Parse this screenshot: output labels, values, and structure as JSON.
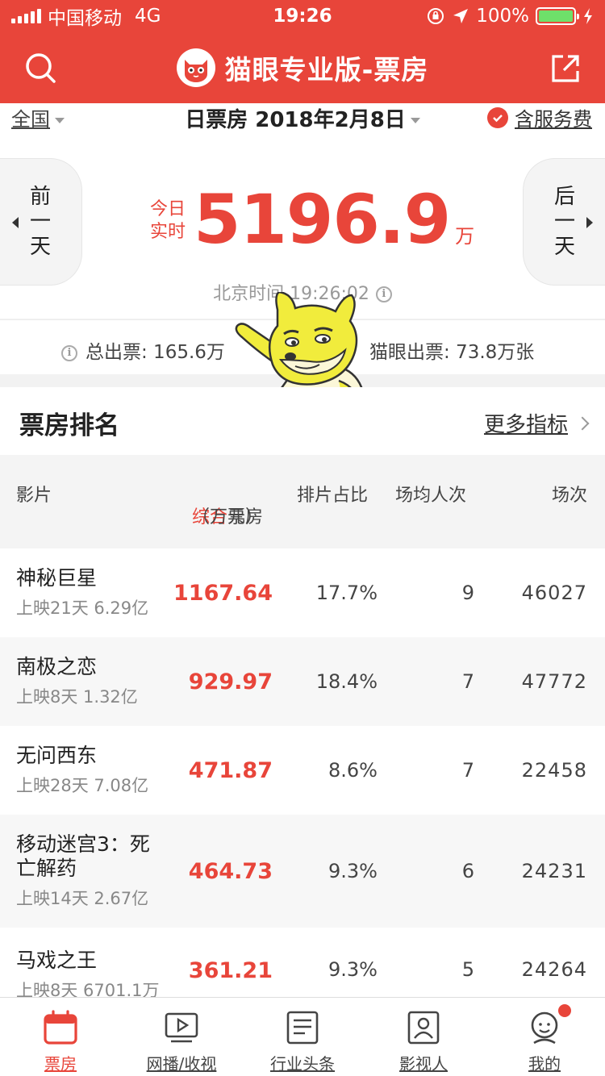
{
  "status_bar": {
    "carrier": "中国移动",
    "network": "4G",
    "time": "19:26",
    "battery": "100%"
  },
  "header": {
    "title": "猫眼专业版-票房",
    "icons": [
      "search-icon",
      "maoyan-logo",
      "share-icon"
    ]
  },
  "filter": {
    "region": "全国",
    "date": "日票房 2018年2月8日",
    "service_fee": "含服务费"
  },
  "summary": {
    "prev_day": [
      "前",
      "一",
      "天"
    ],
    "next_day": [
      "后",
      "一",
      "天"
    ],
    "live_label_1": "今日",
    "live_label_2": "实时",
    "box_office": "5196.9",
    "unit": "万",
    "beijing_time": "北京时间 19:26:02",
    "total_tickets": "总出票: 165.6万",
    "maoyan_tickets": "猫眼出票: 73.8万张"
  },
  "ranking": {
    "title": "票房排名",
    "more": "更多指标",
    "columns": {
      "film": "影片",
      "box_highlight": "综合",
      "box_rest": "票房",
      "box_unit": "（万元）",
      "share": "排片占比",
      "avg": "场均人次",
      "shows": "场次"
    },
    "rows": [
      {
        "name": "神秘巨星",
        "sub": "上映21天 6.29亿",
        "box": "1167.64",
        "share": "17.7%",
        "avg": "9",
        "shows": "46027"
      },
      {
        "name": "南极之恋",
        "sub": "上映8天 1.32亿",
        "box": "929.97",
        "share": "18.4%",
        "avg": "7",
        "shows": "47772"
      },
      {
        "name": "无问西东",
        "sub": "上映28天 7.08亿",
        "box": "471.87",
        "share": "8.6%",
        "avg": "7",
        "shows": "22458"
      },
      {
        "name": "移动迷宫3：死亡解药",
        "sub": "上映14天 2.67亿",
        "box": "464.73",
        "share": "9.3%",
        "avg": "6",
        "shows": "24231"
      },
      {
        "name": "马戏之王",
        "sub": "上映8天 6701.1万",
        "box": "361.21",
        "share": "9.3%",
        "avg": "5",
        "shows": "24264"
      }
    ]
  },
  "tabs": [
    {
      "label": "票房",
      "icon": "calendar-icon",
      "active": true
    },
    {
      "label": "网播/收视",
      "icon": "play-icon",
      "active": false
    },
    {
      "label": "行业头条",
      "icon": "news-icon",
      "active": false
    },
    {
      "label": "影视人",
      "icon": "person-card-icon",
      "active": false
    },
    {
      "label": "我的",
      "icon": "user-icon",
      "active": false,
      "badge": true
    }
  ],
  "colors": {
    "brand_red": "#e8453a",
    "background": "#f2f2f2"
  }
}
